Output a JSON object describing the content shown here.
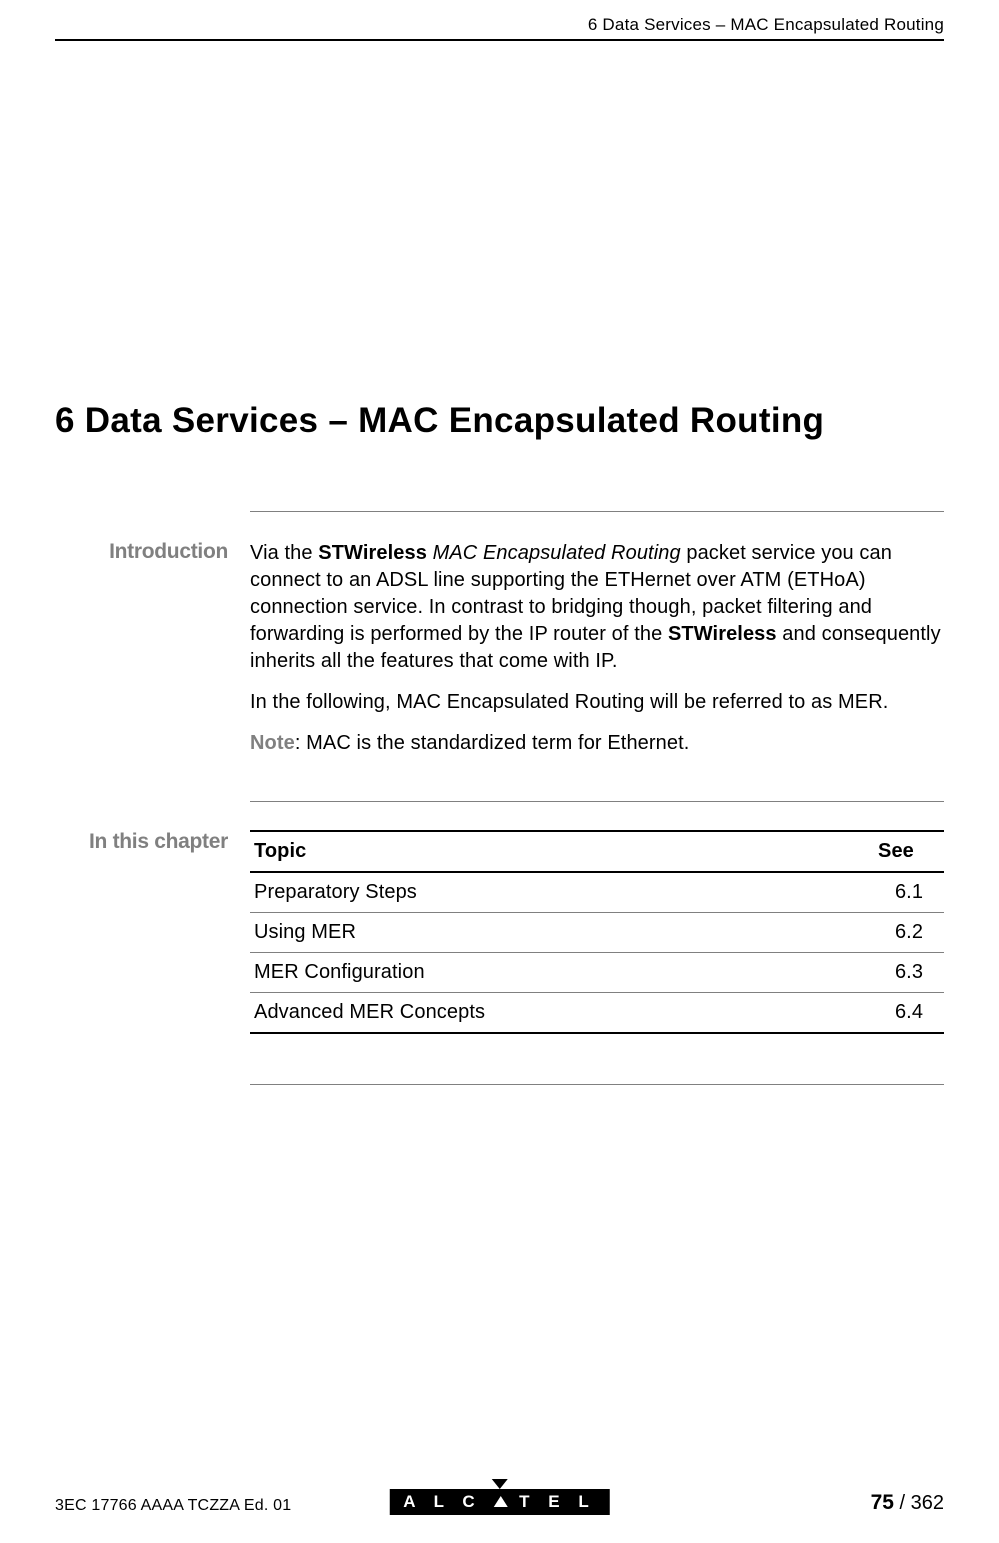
{
  "header": {
    "text": "6   Data Services – MAC Encapsulated Routing"
  },
  "chapter": {
    "title": "6   Data Services – MAC Encapsulated Routing"
  },
  "introduction": {
    "label": "Introduction",
    "para1_part1": "Via the ",
    "para1_bold1": "STWireless",
    "para1_part2": " ",
    "para1_italic": "MAC Encapsulated Routing",
    "para1_part3": " packet service you can connect to an ADSL line supporting the ETHernet over ATM (ETHoA) connection service. In contrast to bridging though, packet filtering and forwarding is performed by the IP router of the ",
    "para1_bold2": "STWireless",
    "para1_part4": " and consequently inherits all the features that come with IP.",
    "para2": "In the following, MAC Encapsulated Routing will be referred to as MER.",
    "note_label": "Note",
    "note_text": ": MAC is the standardized term for Ethernet."
  },
  "inThisChapter": {
    "label": "In this chapter",
    "tableHeaders": {
      "topic": "Topic",
      "see": "See"
    },
    "rows": [
      {
        "topic": "Preparatory Steps",
        "see": "6.1"
      },
      {
        "topic": "Using MER",
        "see": "6.2"
      },
      {
        "topic": "MER Configuration",
        "see": "6.3"
      },
      {
        "topic": "Advanced MER Concepts",
        "see": "6.4"
      }
    ]
  },
  "footer": {
    "left": "3EC 17766 AAAA TCZZA Ed. 01",
    "logo_part1": "A L C",
    "logo_part2": "T E L",
    "pageCurrent": "75",
    "pageSep": " / ",
    "pageTotal": "362"
  }
}
